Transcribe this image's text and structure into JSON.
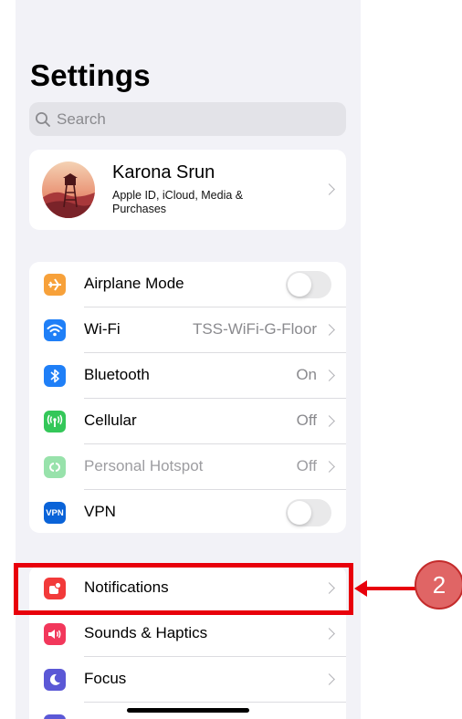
{
  "header": {
    "title": "Settings"
  },
  "search": {
    "placeholder": "Search"
  },
  "profile": {
    "name": "Karona Srun",
    "subtitle": "Apple ID, iCloud, Media & Purchases"
  },
  "network": {
    "airplane": {
      "label": "Airplane Mode",
      "toggle_on": false,
      "icon": "airplane-icon",
      "color": "#f7a13a"
    },
    "wifi": {
      "label": "Wi-Fi",
      "value": "TSS-WiFi-G-Floor",
      "icon": "wifi-icon",
      "color": "#1f7ff7"
    },
    "bluetooth": {
      "label": "Bluetooth",
      "value": "On",
      "icon": "bluetooth-icon",
      "color": "#1f7ff7"
    },
    "cellular": {
      "label": "Cellular",
      "value": "Off",
      "icon": "cellular-icon",
      "color": "#34c759"
    },
    "hotspot": {
      "label": "Personal Hotspot",
      "value": "Off",
      "icon": "hotspot-icon",
      "color": "#34c759"
    },
    "vpn": {
      "label": "VPN",
      "icon_text": "VPN",
      "toggle_on": false,
      "icon": "vpn-icon",
      "color": "#0a63d8"
    }
  },
  "alerts": {
    "notifications": {
      "label": "Notifications",
      "icon": "bell-icon",
      "color": "#f23a3a"
    },
    "sounds": {
      "label": "Sounds & Haptics",
      "icon": "speaker-icon",
      "color": "#f2375b"
    },
    "focus": {
      "label": "Focus",
      "icon": "moon-icon",
      "color": "#5b58d6"
    },
    "screen_time": {
      "icon": "hourglass-icon",
      "color": "#5b58d6"
    }
  },
  "annotation": {
    "step_number": "2",
    "color": "#e8000b"
  }
}
